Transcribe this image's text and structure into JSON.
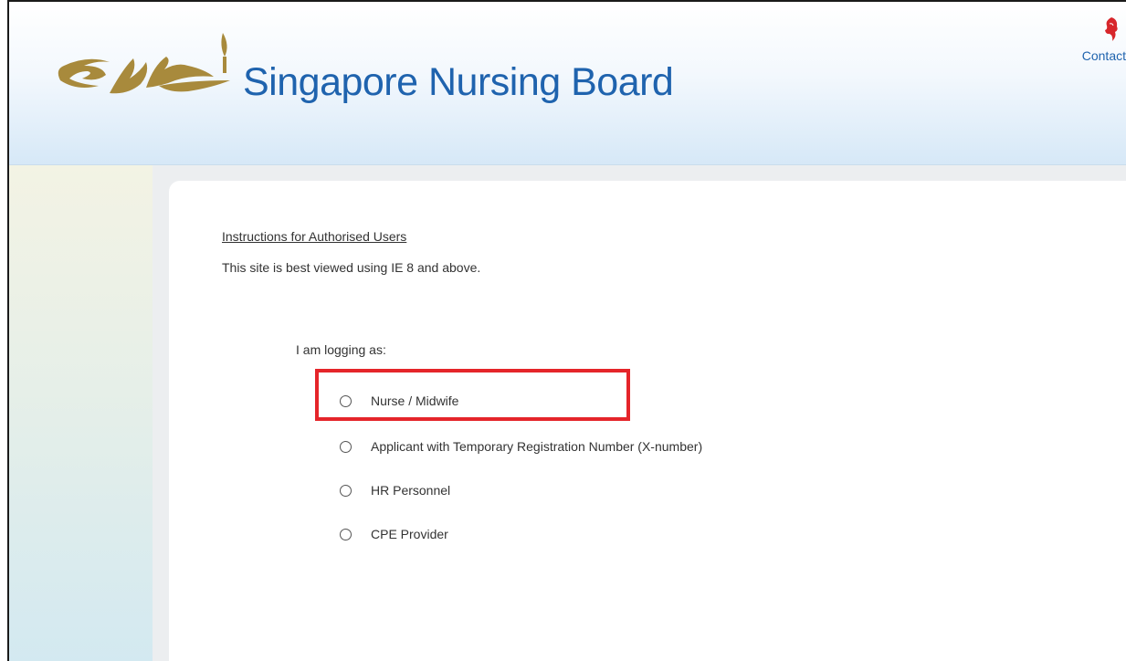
{
  "header": {
    "site_title": "Singapore Nursing Board",
    "contact_label": "Contact",
    "logo_icon": "nursing-lamp-logo-icon",
    "crest_icon": "lion-head-crest-icon"
  },
  "main": {
    "instructions_link": "Instructions for Authorised Users",
    "browser_note": "This site is best viewed using IE 8 and above.",
    "logging_label": "I am logging as:",
    "options": [
      {
        "label": "Nurse / Midwife",
        "selected": false,
        "highlighted": true
      },
      {
        "label": "Applicant with Temporary Registration Number (X-number)",
        "selected": false
      },
      {
        "label": "HR Personnel",
        "selected": false
      },
      {
        "label": "CPE Provider",
        "selected": false
      }
    ]
  },
  "colors": {
    "title_blue": "#1f63ae",
    "logo_gold": "#a88a3c",
    "highlight_red": "#e5252a",
    "crest_red": "#d7262b"
  }
}
